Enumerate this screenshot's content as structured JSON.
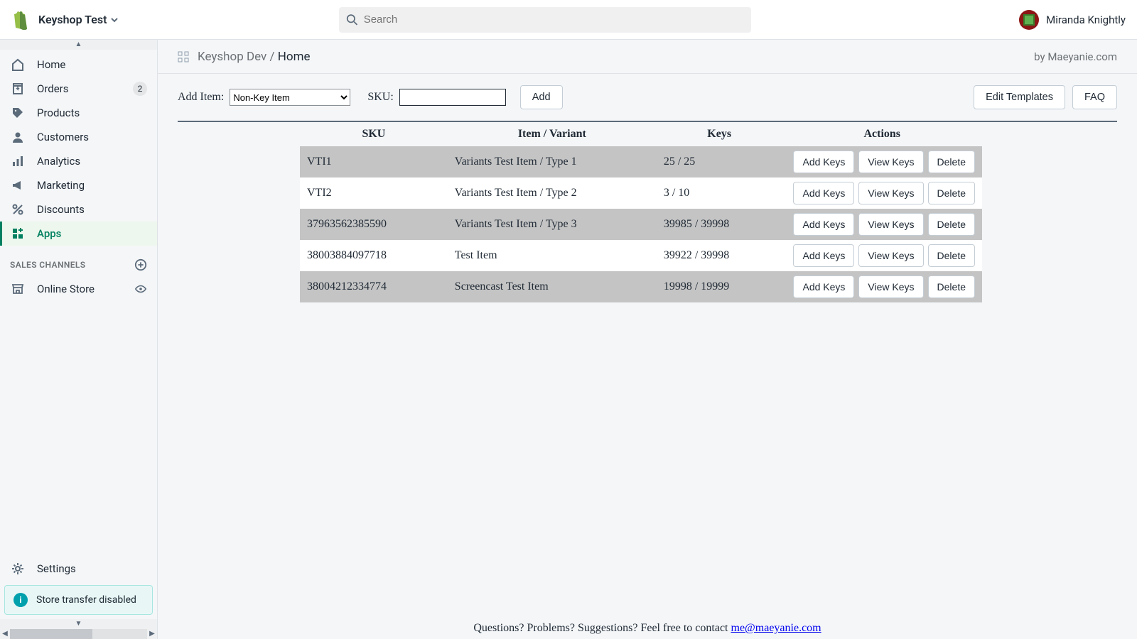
{
  "header": {
    "store_name": "Keyshop Test",
    "search_placeholder": "Search",
    "user_name": "Miranda Knightly"
  },
  "sidebar": {
    "items": [
      {
        "label": "Home",
        "icon": "home"
      },
      {
        "label": "Orders",
        "icon": "orders",
        "badge": "2"
      },
      {
        "label": "Products",
        "icon": "products"
      },
      {
        "label": "Customers",
        "icon": "customers"
      },
      {
        "label": "Analytics",
        "icon": "analytics"
      },
      {
        "label": "Marketing",
        "icon": "marketing"
      },
      {
        "label": "Discounts",
        "icon": "discounts"
      },
      {
        "label": "Apps",
        "icon": "apps",
        "active": true
      }
    ],
    "section_title": "SALES CHANNELS",
    "channels": [
      {
        "label": "Online Store",
        "icon": "store"
      }
    ],
    "settings_label": "Settings",
    "banner_text": "Store transfer disabled"
  },
  "breadcrumb": {
    "app": "Keyshop Dev",
    "page": "Home",
    "byline": "by Maeyanie.com"
  },
  "toolbar": {
    "add_item_label": "Add Item:",
    "select_value": "Non-Key Item",
    "sku_label": "SKU:",
    "add_btn": "Add",
    "edit_templates_btn": "Edit Templates",
    "faq_btn": "FAQ"
  },
  "table": {
    "headers": {
      "sku": "SKU",
      "item": "Item / Variant",
      "keys": "Keys",
      "actions": "Actions"
    },
    "action_labels": {
      "add": "Add Keys",
      "view": "View Keys",
      "delete": "Delete"
    },
    "rows": [
      {
        "sku": "VTI1",
        "item": "Variants Test Item / Type 1",
        "keys": "25 / 25"
      },
      {
        "sku": "VTI2",
        "item": "Variants Test Item / Type 2",
        "keys": "3 / 10"
      },
      {
        "sku": "37963562385590",
        "item": "Variants Test Item / Type 3",
        "keys": "39985 / 39998"
      },
      {
        "sku": "38003884097718",
        "item": "Test Item",
        "keys": "39922 / 39998"
      },
      {
        "sku": "38004212334774",
        "item": "Screencast Test Item",
        "keys": "19998 / 19999"
      }
    ]
  },
  "footer": {
    "text": "Questions? Problems? Suggestions? Feel free to contact ",
    "email": "me@maeyanie.com"
  }
}
